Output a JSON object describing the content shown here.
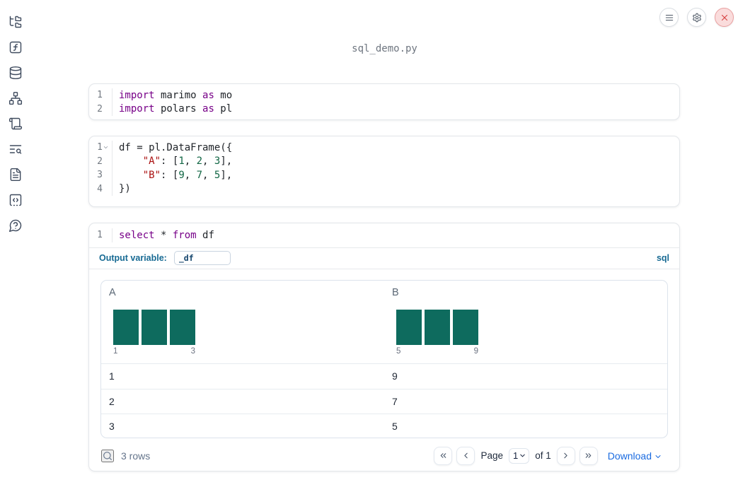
{
  "app": {
    "title": "sql_demo.py"
  },
  "topbar": {
    "buttons": [
      {
        "name": "menu-button",
        "icon": "menu-icon"
      },
      {
        "name": "settings-button",
        "icon": "gear-icon"
      },
      {
        "name": "close-button",
        "icon": "close-icon"
      }
    ]
  },
  "sidebar": {
    "items": [
      {
        "name": "file-explorer",
        "icon": "folder-tree-icon"
      },
      {
        "name": "functions",
        "icon": "function-square-icon"
      },
      {
        "name": "datasources",
        "icon": "database-icon"
      },
      {
        "name": "dependency-graph",
        "icon": "network-icon"
      },
      {
        "name": "logs",
        "icon": "scroll-icon"
      },
      {
        "name": "outline-search",
        "icon": "text-search-icon"
      },
      {
        "name": "documentation",
        "icon": "file-text-icon"
      },
      {
        "name": "snippets",
        "icon": "snippets-code-icon"
      },
      {
        "name": "help",
        "icon": "help-bubble-icon"
      }
    ]
  },
  "cells": [
    {
      "name": "imports-cell",
      "lines": [
        {
          "n": "1",
          "tokens": [
            {
              "t": "import",
              "c": "kw"
            },
            {
              "t": " marimo ",
              "c": "p"
            },
            {
              "t": "as",
              "c": "kw"
            },
            {
              "t": " mo",
              "c": "p"
            }
          ]
        },
        {
          "n": "2",
          "tokens": [
            {
              "t": "import",
              "c": "kw"
            },
            {
              "t": " polars ",
              "c": "p"
            },
            {
              "t": "as",
              "c": "kw"
            },
            {
              "t": " pl",
              "c": "p"
            }
          ]
        }
      ]
    },
    {
      "name": "dataframe-cell",
      "lines": [
        {
          "n": "1",
          "fold": true,
          "tokens": [
            {
              "t": "df = pl.DataFrame({",
              "c": "p"
            }
          ]
        },
        {
          "n": "2",
          "tokens": [
            {
              "t": "    ",
              "c": "p"
            },
            {
              "t": "\"A\"",
              "c": "str"
            },
            {
              "t": ": [",
              "c": "p"
            },
            {
              "t": "1",
              "c": "num"
            },
            {
              "t": ", ",
              "c": "p"
            },
            {
              "t": "2",
              "c": "num"
            },
            {
              "t": ", ",
              "c": "p"
            },
            {
              "t": "3",
              "c": "num"
            },
            {
              "t": "],",
              "c": "p"
            }
          ]
        },
        {
          "n": "3",
          "tokens": [
            {
              "t": "    ",
              "c": "p"
            },
            {
              "t": "\"B\"",
              "c": "str"
            },
            {
              "t": ": [",
              "c": "p"
            },
            {
              "t": "9",
              "c": "num"
            },
            {
              "t": ", ",
              "c": "p"
            },
            {
              "t": "7",
              "c": "num"
            },
            {
              "t": ", ",
              "c": "p"
            },
            {
              "t": "5",
              "c": "num"
            },
            {
              "t": "],",
              "c": "p"
            }
          ]
        },
        {
          "n": "4",
          "tokens": [
            {
              "t": "})",
              "c": "p"
            }
          ]
        }
      ]
    },
    {
      "name": "sql-cell",
      "lines": [
        {
          "n": "1",
          "tokens": [
            {
              "t": "select",
              "c": "kw"
            },
            {
              "t": " * ",
              "c": "p"
            },
            {
              "t": "from",
              "c": "kw"
            },
            {
              "t": " df",
              "c": "p"
            }
          ]
        }
      ]
    }
  ],
  "sql_cell": {
    "output_variable_label": "Output variable:",
    "output_variable_value": "_df",
    "language_badge": "sql"
  },
  "table": {
    "columns": [
      {
        "header": "A",
        "hist_min_label": "1",
        "hist_max_label": "3",
        "hist_bars": [
          1,
          1,
          1
        ]
      },
      {
        "header": "B",
        "hist_min_label": "5",
        "hist_max_label": "9",
        "hist_bars": [
          1,
          1,
          1
        ]
      }
    ],
    "rows": [
      [
        "1",
        "9"
      ],
      [
        "2",
        "7"
      ],
      [
        "3",
        "5"
      ]
    ],
    "footer": {
      "row_count": "3 rows",
      "page_label": "Page",
      "page_value": "1",
      "of_label": "of 1",
      "download_label": "Download"
    }
  },
  "colors": {
    "histogram_bar": "#0e6b5e",
    "code_keyword": "#770088",
    "code_string": "#aa1111",
    "code_number": "#116644",
    "link_blue": "#1a6be0",
    "sql_label_blue": "#176a93",
    "sidebar_icon": "#3f4b5e",
    "close_red": "#d64545"
  }
}
